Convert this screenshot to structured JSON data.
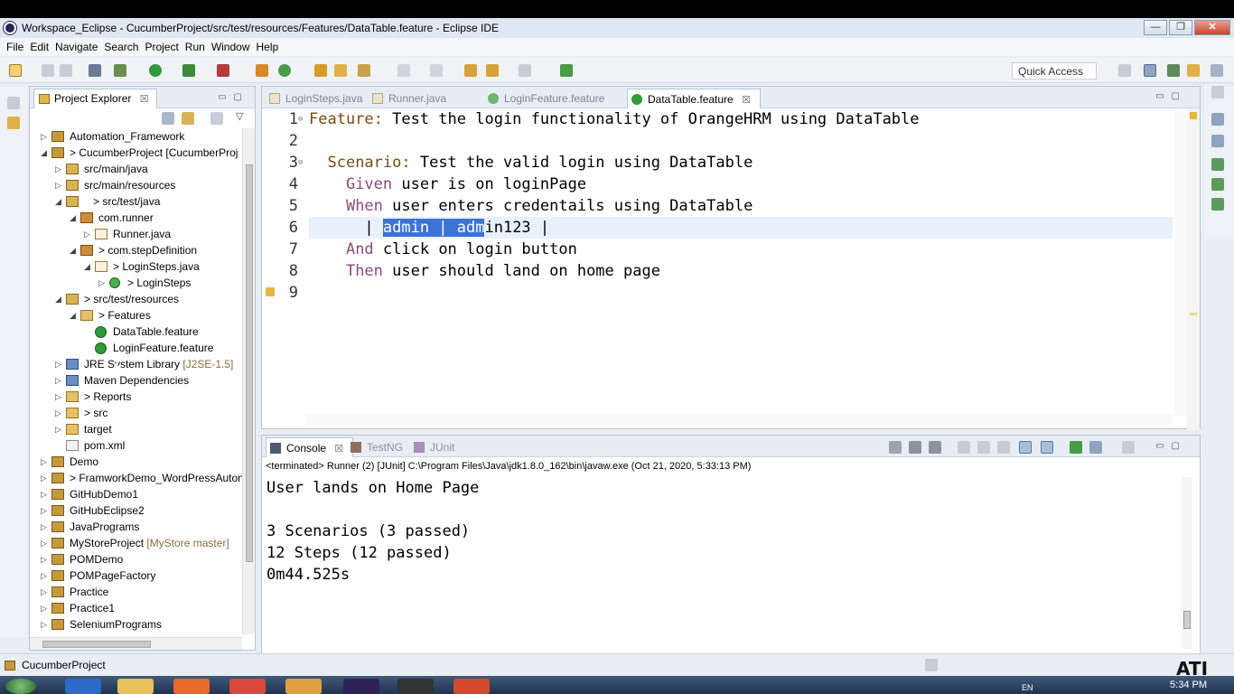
{
  "window": {
    "title": "Workspace_Eclipse - CucumberProject/src/test/resources/Features/DataTable.feature - Eclipse IDE",
    "buttons": {
      "minimize": "—",
      "restore": "❐",
      "close": "✕"
    }
  },
  "menu": [
    "File",
    "Edit",
    "Navigate",
    "Search",
    "Project",
    "Run",
    "Window",
    "Help"
  ],
  "toolbar": {
    "quick_access_placeholder": "Quick Access"
  },
  "explorer": {
    "tab_label": "Project Explorer",
    "tab_close": "☒",
    "items": [
      {
        "label": "Automation_Framework",
        "deco": "",
        "icon": "proj",
        "twisty": "▷"
      },
      {
        "label": "> CucumberProject [CucumberProj",
        "deco": "",
        "icon": "proj",
        "twisty": "◢"
      },
      {
        "label": "src/main/java",
        "deco": "",
        "icon": "src",
        "twisty": "▷"
      },
      {
        "label": "src/main/resources",
        "deco": "",
        "icon": "src",
        "twisty": "▷"
      },
      {
        "label": "> src/test/java",
        "deco": "",
        "icon": "src",
        "twisty": "◢"
      },
      {
        "label": "com.runner",
        "deco": "",
        "icon": "pkg",
        "twisty": "◢"
      },
      {
        "label": "Runner.java",
        "deco": "",
        "icon": "java",
        "twisty": "▷"
      },
      {
        "label": "> com.stepDefinition",
        "deco": "",
        "icon": "pkg",
        "twisty": "◢"
      },
      {
        "label": "> LoginSteps.java",
        "deco": "",
        "icon": "java",
        "twisty": "◢"
      },
      {
        "label": "> LoginSteps",
        "deco": "",
        "icon": "cls",
        "twisty": "▷"
      },
      {
        "label": "> src/test/resources",
        "deco": "",
        "icon": "src",
        "twisty": "◢"
      },
      {
        "label": "> Features",
        "deco": "",
        "icon": "fold",
        "twisty": "◢"
      },
      {
        "label": "DataTable.feature",
        "deco": "",
        "icon": "feat",
        "twisty": ""
      },
      {
        "label": "LoginFeature.feature",
        "deco": "",
        "icon": "feat",
        "twisty": ""
      },
      {
        "label": "JRE System Library ",
        "deco": "[J2SE-1.5]",
        "icon": "lib",
        "twisty": "▷"
      },
      {
        "label": "Maven Dependencies",
        "deco": "",
        "icon": "lib",
        "twisty": "▷"
      },
      {
        "label": "> Reports",
        "deco": "",
        "icon": "fold",
        "twisty": "▷"
      },
      {
        "label": "> src",
        "deco": "",
        "icon": "fold",
        "twisty": "▷"
      },
      {
        "label": "target",
        "deco": "",
        "icon": "fold",
        "twisty": "▷"
      },
      {
        "label": "pom.xml",
        "deco": "",
        "icon": "xml",
        "twisty": ""
      },
      {
        "label": "Demo",
        "deco": "",
        "icon": "proj",
        "twisty": "▷"
      },
      {
        "label": "> FramworkDemo_WordPressAuton",
        "deco": "",
        "icon": "proj",
        "twisty": "▷"
      },
      {
        "label": "GitHubDemo1",
        "deco": "",
        "icon": "proj",
        "twisty": "▷"
      },
      {
        "label": "GitHubEclipse2",
        "deco": "",
        "icon": "proj",
        "twisty": "▷"
      },
      {
        "label": "JavaPrograms",
        "deco": "",
        "icon": "proj",
        "twisty": "▷"
      },
      {
        "label": "MyStoreProject ",
        "deco": "[MyStore master]",
        "icon": "proj",
        "twisty": "▷"
      },
      {
        "label": "POMDemo",
        "deco": "",
        "icon": "proj",
        "twisty": "▷"
      },
      {
        "label": "POMPageFactory",
        "deco": "",
        "icon": "proj",
        "twisty": "▷"
      },
      {
        "label": "Practice",
        "deco": "",
        "icon": "proj",
        "twisty": "▷"
      },
      {
        "label": "Practice1",
        "deco": "",
        "icon": "proj",
        "twisty": "▷"
      },
      {
        "label": "SeleniumPrograms",
        "deco": "",
        "icon": "proj",
        "twisty": "▷"
      }
    ]
  },
  "editor": {
    "tabs": [
      {
        "label": "LoginSteps.java",
        "active": false
      },
      {
        "label": "Runner.java",
        "active": false
      },
      {
        "label": "LoginFeature.feature",
        "active": false
      },
      {
        "label": "DataTable.feature",
        "active": true
      }
    ],
    "tab_close": "☒",
    "lines": [
      {
        "n": "1",
        "kw": "Feature:",
        "rest": " Test the login functionality of OrangeHRM using DataTable",
        "indent": ""
      },
      {
        "n": "2",
        "kw": "",
        "rest": "",
        "indent": ""
      },
      {
        "n": "3",
        "kw": "Scenario:",
        "rest": " Test the valid login using DataTable",
        "indent": "  "
      },
      {
        "n": "4",
        "kw": "Given",
        "rest": " user is on loginPage",
        "indent": "    "
      },
      {
        "n": "5",
        "kw": "When",
        "rest": " user enters credentails using DataTable",
        "indent": "    "
      },
      {
        "n": "6",
        "kw": "",
        "rest": "",
        "indent": ""
      },
      {
        "n": "7",
        "kw": "And",
        "rest": " click on login button",
        "indent": "    "
      },
      {
        "n": "8",
        "kw": "Then",
        "rest": " user should land on home page",
        "indent": "    "
      },
      {
        "n": "9",
        "kw": "",
        "rest": "",
        "indent": ""
      }
    ],
    "table_line": {
      "prefix": "      | ",
      "selected": "admin | adm",
      "suffix": "in123 |"
    }
  },
  "console": {
    "tabs": [
      {
        "label": "Console",
        "active": true
      },
      {
        "label": "TestNG",
        "active": false
      },
      {
        "label": "JUnit",
        "active": false
      }
    ],
    "terminated": "<terminated> Runner (2) [JUnit] C:\\Program Files\\Java\\jdk1.8.0_162\\bin\\javaw.exe (Oct 21, 2020, 5:33:13 PM)",
    "output": "User lands on Home Page\n\n3 Scenarios (3 passed)\n12 Steps (12 passed)\n0m44.525s"
  },
  "status": {
    "text": "CucumberProject"
  },
  "taskbar": {
    "lang": "EN",
    "clock": "5:34 PM"
  },
  "watermark": "ATI"
}
